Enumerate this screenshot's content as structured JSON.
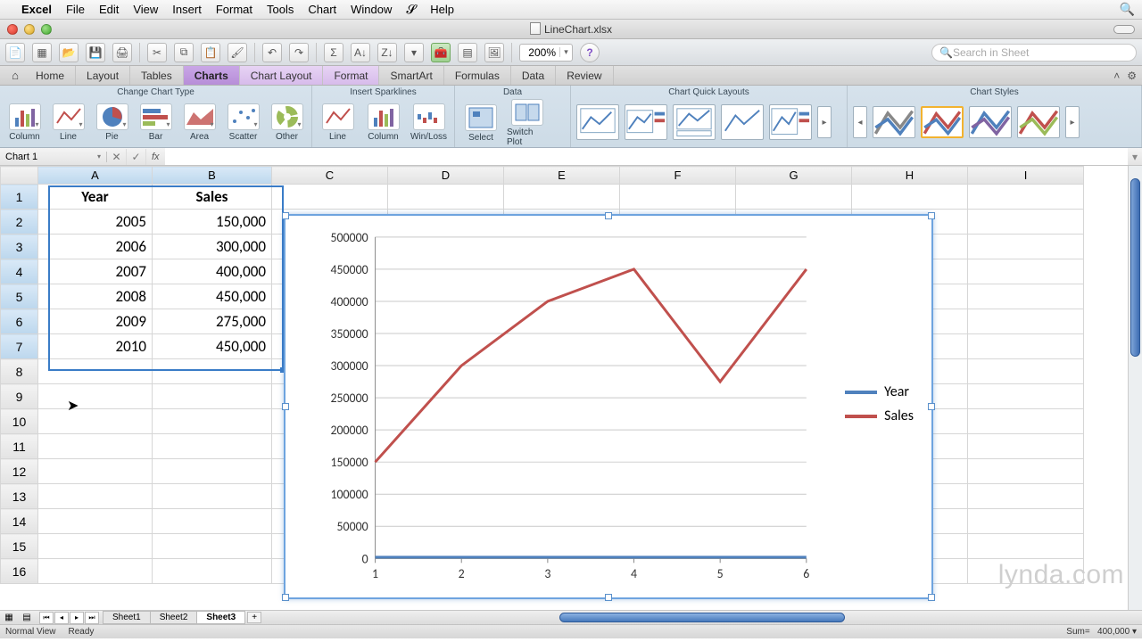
{
  "menubar": {
    "app": "Excel",
    "items": [
      "File",
      "Edit",
      "View",
      "Insert",
      "Format",
      "Tools",
      "Chart",
      "Window"
    ],
    "scripts_icon": "scripts-icon",
    "help": "Help"
  },
  "titlebar": {
    "title": "LineChart.xlsx"
  },
  "toolbar": {
    "zoom": "200%",
    "search_placeholder": "Search in Sheet"
  },
  "ribbon": {
    "tabs": [
      "Home",
      "Layout",
      "Tables",
      "Charts",
      "Chart Layout",
      "Format",
      "SmartArt",
      "Formulas",
      "Data",
      "Review"
    ],
    "active_tab": "Charts",
    "context_tabs": [
      "Chart Layout",
      "Format"
    ],
    "groups": {
      "change_type": {
        "label": "Change Chart Type",
        "items": [
          "Column",
          "Line",
          "Pie",
          "Bar",
          "Area",
          "Scatter",
          "Other"
        ]
      },
      "sparklines": {
        "label": "Insert Sparklines",
        "items": [
          "Line",
          "Column",
          "Win/Loss"
        ]
      },
      "data": {
        "label": "Data",
        "items": [
          "Select",
          "Switch Plot"
        ]
      },
      "quick_layouts": {
        "label": "Chart Quick Layouts"
      },
      "styles": {
        "label": "Chart Styles"
      }
    }
  },
  "namebox": "Chart 1",
  "fx_label": "fx",
  "sheet": {
    "columns": [
      "A",
      "B",
      "C",
      "D",
      "E",
      "F",
      "G",
      "H",
      "I"
    ],
    "selected_cols": [
      "A",
      "B"
    ],
    "selected_rows": [
      1,
      2,
      3,
      4,
      5,
      6,
      7
    ],
    "headers": {
      "A": "Year",
      "B": "Sales"
    },
    "rows": [
      {
        "n": 1
      },
      {
        "n": 2,
        "A": "2005",
        "B": "150,000"
      },
      {
        "n": 3,
        "A": "2006",
        "B": "300,000"
      },
      {
        "n": 4,
        "A": "2007",
        "B": "400,000"
      },
      {
        "n": 5,
        "A": "2008",
        "B": "450,000"
      },
      {
        "n": 6,
        "A": "2009",
        "B": "275,000"
      },
      {
        "n": 7,
        "A": "2010",
        "B": "450,000"
      },
      {
        "n": 8
      },
      {
        "n": 9
      },
      {
        "n": 10
      },
      {
        "n": 11
      },
      {
        "n": 12
      },
      {
        "n": 13
      },
      {
        "n": 14
      },
      {
        "n": 15
      },
      {
        "n": 16
      }
    ]
  },
  "chart_data": {
    "type": "line",
    "x": [
      1,
      2,
      3,
      4,
      5,
      6
    ],
    "series": [
      {
        "name": "Year",
        "color": "#4f81bd",
        "values": [
          2005,
          2006,
          2007,
          2008,
          2009,
          2010
        ]
      },
      {
        "name": "Sales",
        "color": "#c0504d",
        "values": [
          150000,
          300000,
          400000,
          450000,
          275000,
          450000
        ]
      }
    ],
    "ylim": [
      0,
      500000
    ],
    "ytick": 50000,
    "xlabel": "",
    "ylabel": "",
    "title": "",
    "legend_position": "right",
    "grid": true
  },
  "sheet_tabs": {
    "tabs": [
      "Sheet1",
      "Sheet2",
      "Sheet3"
    ],
    "active": "Sheet3"
  },
  "statusbar": {
    "view": "Normal View",
    "state": "Ready",
    "sum_label": "Sum=",
    "sum_value": "400,000"
  },
  "watermark": "lynda.com"
}
